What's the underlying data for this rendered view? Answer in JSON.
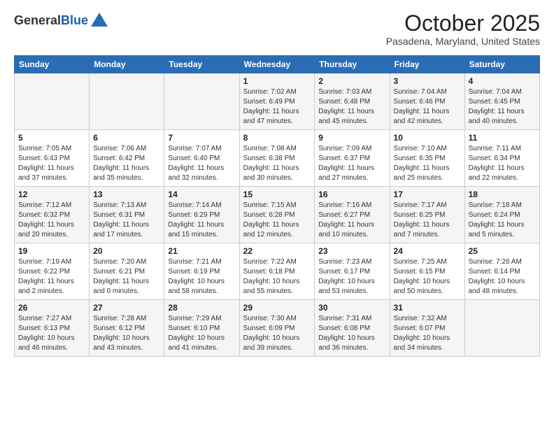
{
  "logo": {
    "general": "General",
    "blue": "Blue"
  },
  "header": {
    "month": "October 2025",
    "location": "Pasadena, Maryland, United States"
  },
  "days_of_week": [
    "Sunday",
    "Monday",
    "Tuesday",
    "Wednesday",
    "Thursday",
    "Friday",
    "Saturday"
  ],
  "weeks": [
    [
      {
        "day": "",
        "info": ""
      },
      {
        "day": "",
        "info": ""
      },
      {
        "day": "",
        "info": ""
      },
      {
        "day": "1",
        "info": "Sunrise: 7:02 AM\nSunset: 6:49 PM\nDaylight: 11 hours and 47 minutes."
      },
      {
        "day": "2",
        "info": "Sunrise: 7:03 AM\nSunset: 6:48 PM\nDaylight: 11 hours and 45 minutes."
      },
      {
        "day": "3",
        "info": "Sunrise: 7:04 AM\nSunset: 6:46 PM\nDaylight: 11 hours and 42 minutes."
      },
      {
        "day": "4",
        "info": "Sunrise: 7:04 AM\nSunset: 6:45 PM\nDaylight: 11 hours and 40 minutes."
      }
    ],
    [
      {
        "day": "5",
        "info": "Sunrise: 7:05 AM\nSunset: 6:43 PM\nDaylight: 11 hours and 37 minutes."
      },
      {
        "day": "6",
        "info": "Sunrise: 7:06 AM\nSunset: 6:42 PM\nDaylight: 11 hours and 35 minutes."
      },
      {
        "day": "7",
        "info": "Sunrise: 7:07 AM\nSunset: 6:40 PM\nDaylight: 11 hours and 32 minutes."
      },
      {
        "day": "8",
        "info": "Sunrise: 7:08 AM\nSunset: 6:38 PM\nDaylight: 11 hours and 30 minutes."
      },
      {
        "day": "9",
        "info": "Sunrise: 7:09 AM\nSunset: 6:37 PM\nDaylight: 11 hours and 27 minutes."
      },
      {
        "day": "10",
        "info": "Sunrise: 7:10 AM\nSunset: 6:35 PM\nDaylight: 11 hours and 25 minutes."
      },
      {
        "day": "11",
        "info": "Sunrise: 7:11 AM\nSunset: 6:34 PM\nDaylight: 11 hours and 22 minutes."
      }
    ],
    [
      {
        "day": "12",
        "info": "Sunrise: 7:12 AM\nSunset: 6:32 PM\nDaylight: 11 hours and 20 minutes."
      },
      {
        "day": "13",
        "info": "Sunrise: 7:13 AM\nSunset: 6:31 PM\nDaylight: 11 hours and 17 minutes."
      },
      {
        "day": "14",
        "info": "Sunrise: 7:14 AM\nSunset: 6:29 PM\nDaylight: 11 hours and 15 minutes."
      },
      {
        "day": "15",
        "info": "Sunrise: 7:15 AM\nSunset: 6:28 PM\nDaylight: 11 hours and 12 minutes."
      },
      {
        "day": "16",
        "info": "Sunrise: 7:16 AM\nSunset: 6:27 PM\nDaylight: 11 hours and 10 minutes."
      },
      {
        "day": "17",
        "info": "Sunrise: 7:17 AM\nSunset: 6:25 PM\nDaylight: 11 hours and 7 minutes."
      },
      {
        "day": "18",
        "info": "Sunrise: 7:18 AM\nSunset: 6:24 PM\nDaylight: 11 hours and 5 minutes."
      }
    ],
    [
      {
        "day": "19",
        "info": "Sunrise: 7:19 AM\nSunset: 6:22 PM\nDaylight: 11 hours and 2 minutes."
      },
      {
        "day": "20",
        "info": "Sunrise: 7:20 AM\nSunset: 6:21 PM\nDaylight: 11 hours and 0 minutes."
      },
      {
        "day": "21",
        "info": "Sunrise: 7:21 AM\nSunset: 6:19 PM\nDaylight: 10 hours and 58 minutes."
      },
      {
        "day": "22",
        "info": "Sunrise: 7:22 AM\nSunset: 6:18 PM\nDaylight: 10 hours and 55 minutes."
      },
      {
        "day": "23",
        "info": "Sunrise: 7:23 AM\nSunset: 6:17 PM\nDaylight: 10 hours and 53 minutes."
      },
      {
        "day": "24",
        "info": "Sunrise: 7:25 AM\nSunset: 6:15 PM\nDaylight: 10 hours and 50 minutes."
      },
      {
        "day": "25",
        "info": "Sunrise: 7:26 AM\nSunset: 6:14 PM\nDaylight: 10 hours and 48 minutes."
      }
    ],
    [
      {
        "day": "26",
        "info": "Sunrise: 7:27 AM\nSunset: 6:13 PM\nDaylight: 10 hours and 46 minutes."
      },
      {
        "day": "27",
        "info": "Sunrise: 7:28 AM\nSunset: 6:12 PM\nDaylight: 10 hours and 43 minutes."
      },
      {
        "day": "28",
        "info": "Sunrise: 7:29 AM\nSunset: 6:10 PM\nDaylight: 10 hours and 41 minutes."
      },
      {
        "day": "29",
        "info": "Sunrise: 7:30 AM\nSunset: 6:09 PM\nDaylight: 10 hours and 39 minutes."
      },
      {
        "day": "30",
        "info": "Sunrise: 7:31 AM\nSunset: 6:08 PM\nDaylight: 10 hours and 36 minutes."
      },
      {
        "day": "31",
        "info": "Sunrise: 7:32 AM\nSunset: 6:07 PM\nDaylight: 10 hours and 34 minutes."
      },
      {
        "day": "",
        "info": ""
      }
    ]
  ]
}
